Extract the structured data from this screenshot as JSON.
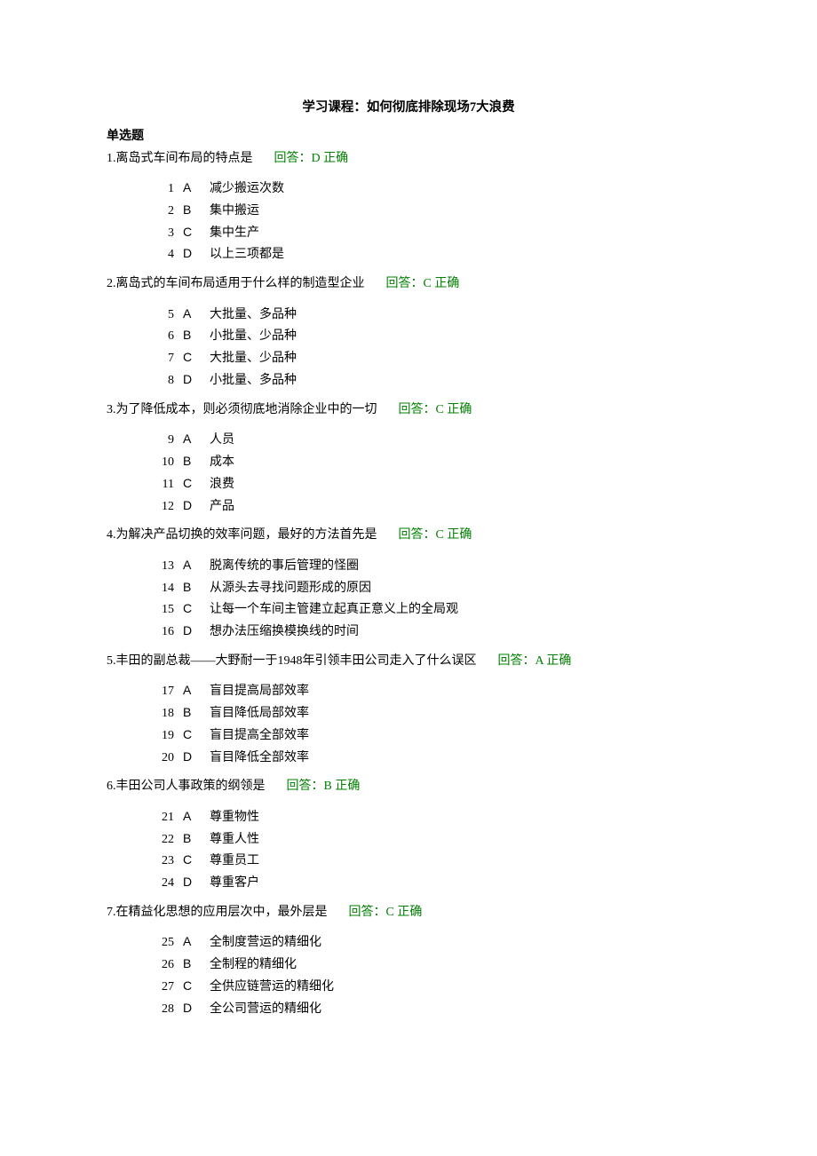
{
  "title": "学习课程：如何彻底排除现场7大浪费",
  "sectionHeading": "单选题",
  "questions": [
    {
      "stem": "1.离岛式车间布局的特点是",
      "answer": "回答：D 正确",
      "options": [
        {
          "num": "1",
          "letter": "A",
          "text": "减少搬运次数"
        },
        {
          "num": "2",
          "letter": "B",
          "text": "集中搬运"
        },
        {
          "num": "3",
          "letter": "C",
          "text": "集中生产"
        },
        {
          "num": "4",
          "letter": "D",
          "text": "以上三项都是"
        }
      ]
    },
    {
      "stem": "2.离岛式的车间布局适用于什么样的制造型企业",
      "answer": "回答：C 正确",
      "options": [
        {
          "num": "5",
          "letter": "A",
          "text": "大批量、多品种"
        },
        {
          "num": "6",
          "letter": "B",
          "text": "小批量、少品种"
        },
        {
          "num": "7",
          "letter": "C",
          "text": "大批量、少品种"
        },
        {
          "num": "8",
          "letter": "D",
          "text": "小批量、多品种"
        }
      ]
    },
    {
      "stem": "3.为了降低成本，则必须彻底地消除企业中的一切",
      "answer": "回答：C 正确",
      "options": [
        {
          "num": "9",
          "letter": "A",
          "text": "人员"
        },
        {
          "num": "10",
          "letter": "B",
          "text": "成本"
        },
        {
          "num": "11",
          "letter": "C",
          "text": "浪费"
        },
        {
          "num": "12",
          "letter": "D",
          "text": "产品"
        }
      ]
    },
    {
      "stem": "4.为解决产品切换的效率问题，最好的方法首先是",
      "answer": "回答：C 正确",
      "options": [
        {
          "num": "13",
          "letter": "A",
          "text": "脱离传统的事后管理的怪圈"
        },
        {
          "num": "14",
          "letter": "B",
          "text": "从源头去寻找问题形成的原因"
        },
        {
          "num": "15",
          "letter": "C",
          "text": "让每一个车间主管建立起真正意义上的全局观"
        },
        {
          "num": "16",
          "letter": "D",
          "text": "想办法压缩换模换线的时间"
        }
      ]
    },
    {
      "stem": "5.丰田的副总裁——大野耐一于1948年引领丰田公司走入了什么误区",
      "answer": "回答：A 正确",
      "options": [
        {
          "num": "17",
          "letter": "A",
          "text": "盲目提高局部效率"
        },
        {
          "num": "18",
          "letter": "B",
          "text": "盲目降低局部效率"
        },
        {
          "num": "19",
          "letter": "C",
          "text": "盲目提高全部效率"
        },
        {
          "num": "20",
          "letter": "D",
          "text": "盲目降低全部效率"
        }
      ]
    },
    {
      "stem": "6.丰田公司人事政策的纲领是",
      "answer": "回答：B 正确",
      "options": [
        {
          "num": "21",
          "letter": "A",
          "text": "尊重物性"
        },
        {
          "num": "22",
          "letter": "B",
          "text": "尊重人性"
        },
        {
          "num": "23",
          "letter": "C",
          "text": "尊重员工"
        },
        {
          "num": "24",
          "letter": "D",
          "text": "尊重客户"
        }
      ]
    },
    {
      "stem": "7.在精益化思想的应用层次中，最外层是",
      "answer": "回答：C 正确",
      "options": [
        {
          "num": "25",
          "letter": "A",
          "text": "全制度营运的精细化"
        },
        {
          "num": "26",
          "letter": "B",
          "text": "全制程的精细化"
        },
        {
          "num": "27",
          "letter": "C",
          "text": "全供应链营运的精细化"
        },
        {
          "num": "28",
          "letter": "D",
          "text": "全公司营运的精细化"
        }
      ]
    }
  ]
}
